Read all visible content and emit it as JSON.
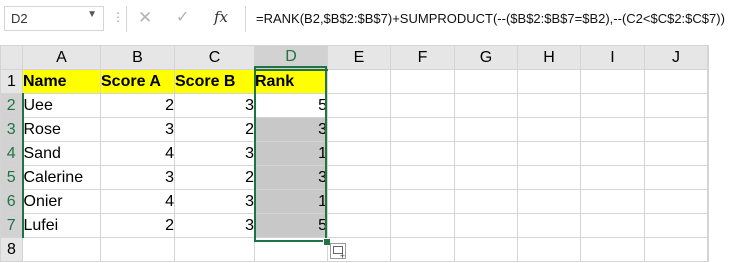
{
  "formula_bar": {
    "name_box": "D2",
    "formula": "=RANK(B2,$B$2:$B$7)+SUMPRODUCT(--($B$2:$B$7=$B2),--(C2<$C$2:$C$7))",
    "fx": "fx"
  },
  "columns": [
    "A",
    "B",
    "C",
    "D",
    "E",
    "F",
    "G",
    "H",
    "I",
    "J"
  ],
  "rows": [
    "1",
    "2",
    "3",
    "4",
    "5",
    "6",
    "7",
    "8"
  ],
  "table": {
    "headers": [
      "Name",
      "Score A",
      "Score B",
      "Rank"
    ],
    "data": [
      [
        "Uee",
        "2",
        "3",
        "5"
      ],
      [
        "Rose",
        "3",
        "2",
        "3"
      ],
      [
        "Sand",
        "4",
        "3",
        "1"
      ],
      [
        "Calerine",
        "3",
        "2",
        "3"
      ],
      [
        "Onier",
        "4",
        "3",
        "1"
      ],
      [
        "Lufei",
        "2",
        "3",
        "5"
      ]
    ]
  },
  "colors": {
    "header_fill": "#ffff00",
    "selection": "#217346",
    "rank_fill": "#c8c8c8"
  }
}
